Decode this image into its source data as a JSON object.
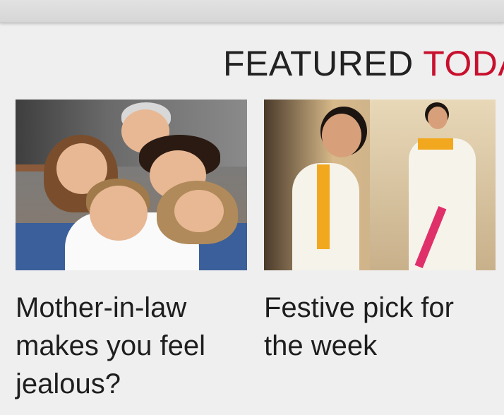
{
  "section": {
    "title_main": "FEATURED ",
    "title_accent": "TODA",
    "accent_color": "#c8102e"
  },
  "cards": [
    {
      "headline": "Mother-in-law makes you feel jealous?",
      "image": "family-photo"
    },
    {
      "headline": "Festive pick for the week",
      "image": "saree-photo"
    }
  ]
}
